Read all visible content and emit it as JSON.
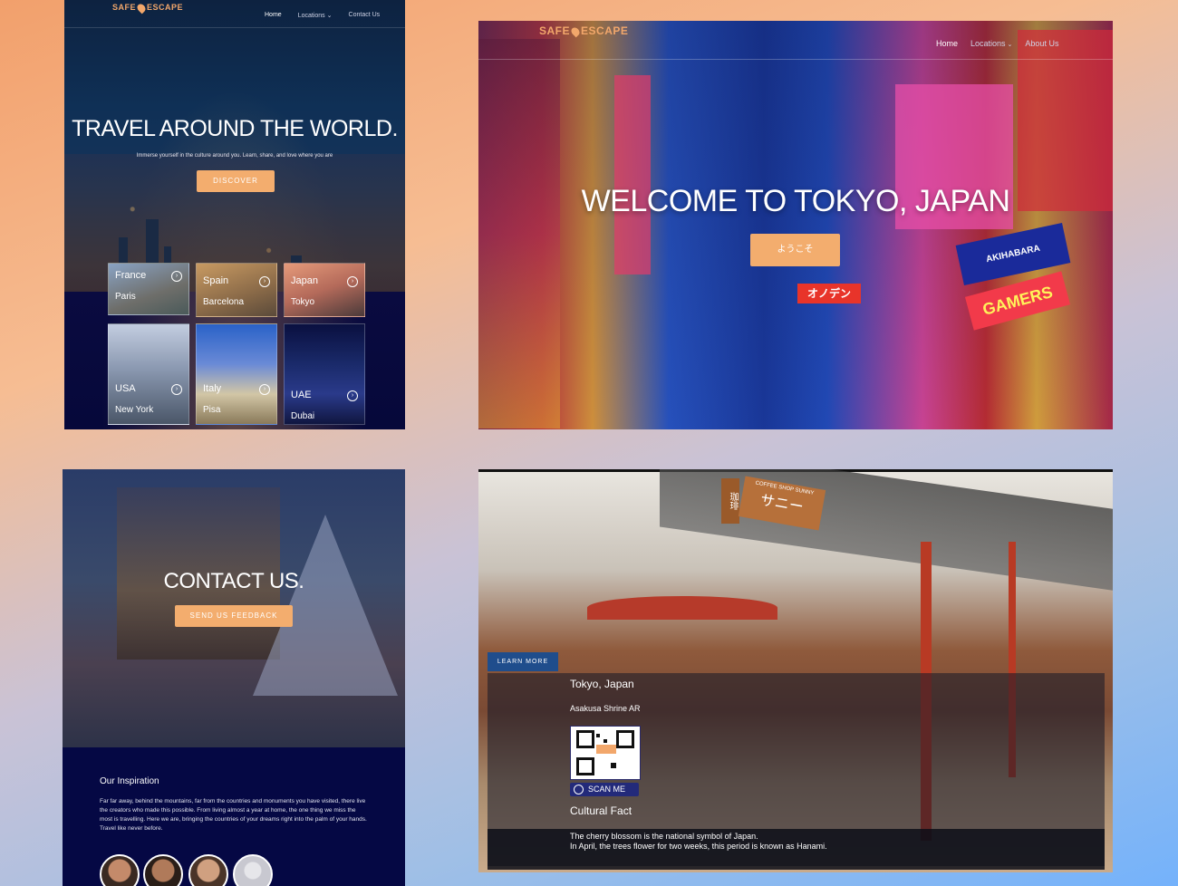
{
  "brand": {
    "logo_left": "SAFE",
    "logo_right": "ESCAPE"
  },
  "panel1": {
    "nav": {
      "home": "Home",
      "locations": "Locations",
      "contact": "Contact Us"
    },
    "title": "TRAVEL AROUND THE WORLD.",
    "subtitle": "Immerse yourself in the culture around you. Learn, share, and love where you are",
    "button": "DISCOVER",
    "cards": [
      {
        "country": "France",
        "city": "Paris"
      },
      {
        "country": "Spain",
        "city": "Barcelona"
      },
      {
        "country": "Japan",
        "city": "Tokyo"
      },
      {
        "country": "USA",
        "city": "New York"
      },
      {
        "country": "Italy",
        "city": "Pisa"
      },
      {
        "country": "UAE",
        "city": "Dubai"
      }
    ]
  },
  "panel2": {
    "nav": {
      "home": "Home",
      "locations": "Locations",
      "about": "About Us"
    },
    "title": "WELCOME TO TOKYO, JAPAN",
    "button": "ようこそ",
    "signs": {
      "akihabara": "AKIHABARA",
      "gamers": "GAMERS",
      "oden": "オノデン"
    }
  },
  "panel3": {
    "title": "CONTACT US.",
    "button": "SEND US FEEDBACK",
    "inspiration_heading": "Our Inspiration",
    "inspiration_text": "Far far away, behind the mountains, far from the countries and monuments you have visited, there live the creators who made this possible. From living almost a year at home, the one thing we miss the most is travelling. Here we are, bringing the countries of your dreams right into the palm of your hands. Travel like never before."
  },
  "panel4": {
    "learn_more": "LEARN MORE",
    "location": "Tokyo, Japan",
    "subtitle": "Asakusa Shrine AR",
    "scan_label": "SCAN ME",
    "fact_heading": "Cultural Fact",
    "fact_line1": "The cherry blossom is the national symbol of Japan.",
    "fact_line2": "In April, the trees flower for two weeks, this period is known as Hanami.",
    "shop_sign": "サニー",
    "coffee_sign": "COFFEE SHOP SUNNY"
  },
  "colors": {
    "accent": "#f3ad6e",
    "navy": "#050844",
    "learn_more": "#1f4d8c"
  },
  "icons": [
    "pin-icon",
    "arrow-right-icon",
    "qr-code-icon",
    "scan-icon",
    "chevron-down-icon"
  ]
}
